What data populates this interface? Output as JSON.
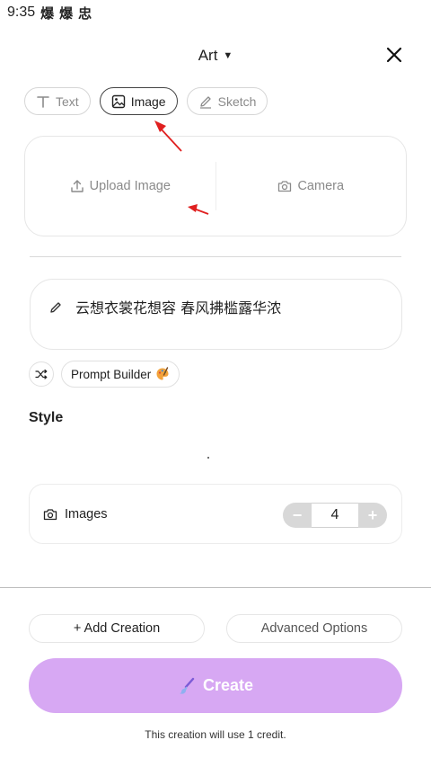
{
  "status_bar": {
    "time": "9:35",
    "icons": [
      "notification-icon",
      "notification-icon",
      "bug-icon"
    ],
    "glyphs": [
      "爆",
      "爆",
      "忠"
    ]
  },
  "header": {
    "title": "Art",
    "close_icon": "close-icon"
  },
  "mode_tabs": [
    {
      "label": "Text",
      "icon": "text-icon",
      "active": false
    },
    {
      "label": "Image",
      "icon": "image-icon",
      "active": true
    },
    {
      "label": "Sketch",
      "icon": "pencil-icon",
      "active": false
    }
  ],
  "upload": {
    "upload_label": "Upload Image",
    "camera_label": "Camera"
  },
  "prompt": {
    "text": "云想衣裳花想容 春风拂槛露华浓"
  },
  "prompt_tools": {
    "builder_label": "Prompt Builder"
  },
  "style": {
    "heading": "Style"
  },
  "images_setting": {
    "label": "Images",
    "value": "4",
    "minus": "−",
    "plus": "+"
  },
  "actions": {
    "add_creation": "+ Add Creation",
    "advanced_options": "Advanced Options",
    "create": "Create"
  },
  "credit_note": "This creation will use 1 credit.",
  "colors": {
    "create_button": "#d7a8f3",
    "annotation_arrow": "#e02020"
  }
}
